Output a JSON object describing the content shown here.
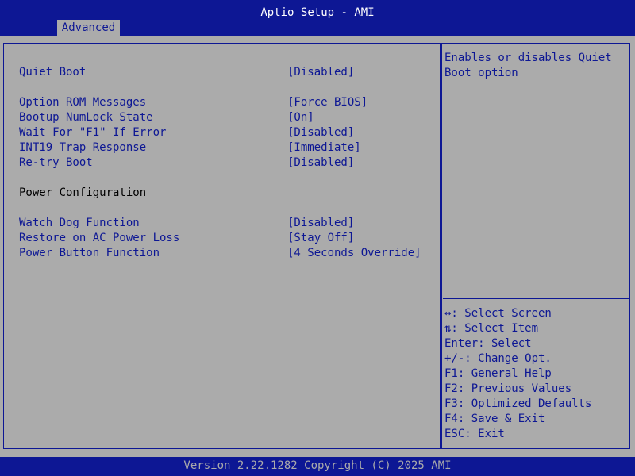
{
  "header": {
    "title": "Aptio Setup - AMI",
    "tab": "Advanced"
  },
  "settings": {
    "quiet_boot": {
      "label": "Quiet Boot",
      "value": "[Disabled]"
    },
    "option_rom": {
      "label": "Option ROM Messages",
      "value": "[Force BIOS]"
    },
    "numlock": {
      "label": "Bootup NumLock State",
      "value": "[On]"
    },
    "wait_f1": {
      "label": "Wait For \"F1\" If Error",
      "value": "[Disabled]"
    },
    "int19": {
      "label": "INT19 Trap Response",
      "value": "[Immediate]"
    },
    "retry_boot": {
      "label": "Re-try Boot",
      "value": "[Disabled]"
    },
    "power_section": "Power Configuration",
    "watchdog": {
      "label": "Watch Dog Function",
      "value": "[Disabled]"
    },
    "restore_ac": {
      "label": "Restore on AC Power Loss",
      "value": "[Stay Off]"
    },
    "power_button": {
      "label": "Power Button Function",
      "value": "[4 Seconds Override]"
    }
  },
  "help": {
    "line1": "Enables or disables Quiet",
    "line2": "Boot option"
  },
  "keys": [
    "↔: Select Screen",
    "⇅: Select Item",
    "Enter: Select",
    "+/-: Change Opt.",
    "F1: General Help",
    "F2: Previous Values",
    "F3: Optimized Defaults",
    "F4: Save & Exit",
    "ESC: Exit"
  ],
  "footer": {
    "version": "Version 2.22.1282 Copyright (C) 2025 AMI"
  },
  "colors": {
    "bios_blue": "#0d1794",
    "panel_gray": "#ababab"
  }
}
